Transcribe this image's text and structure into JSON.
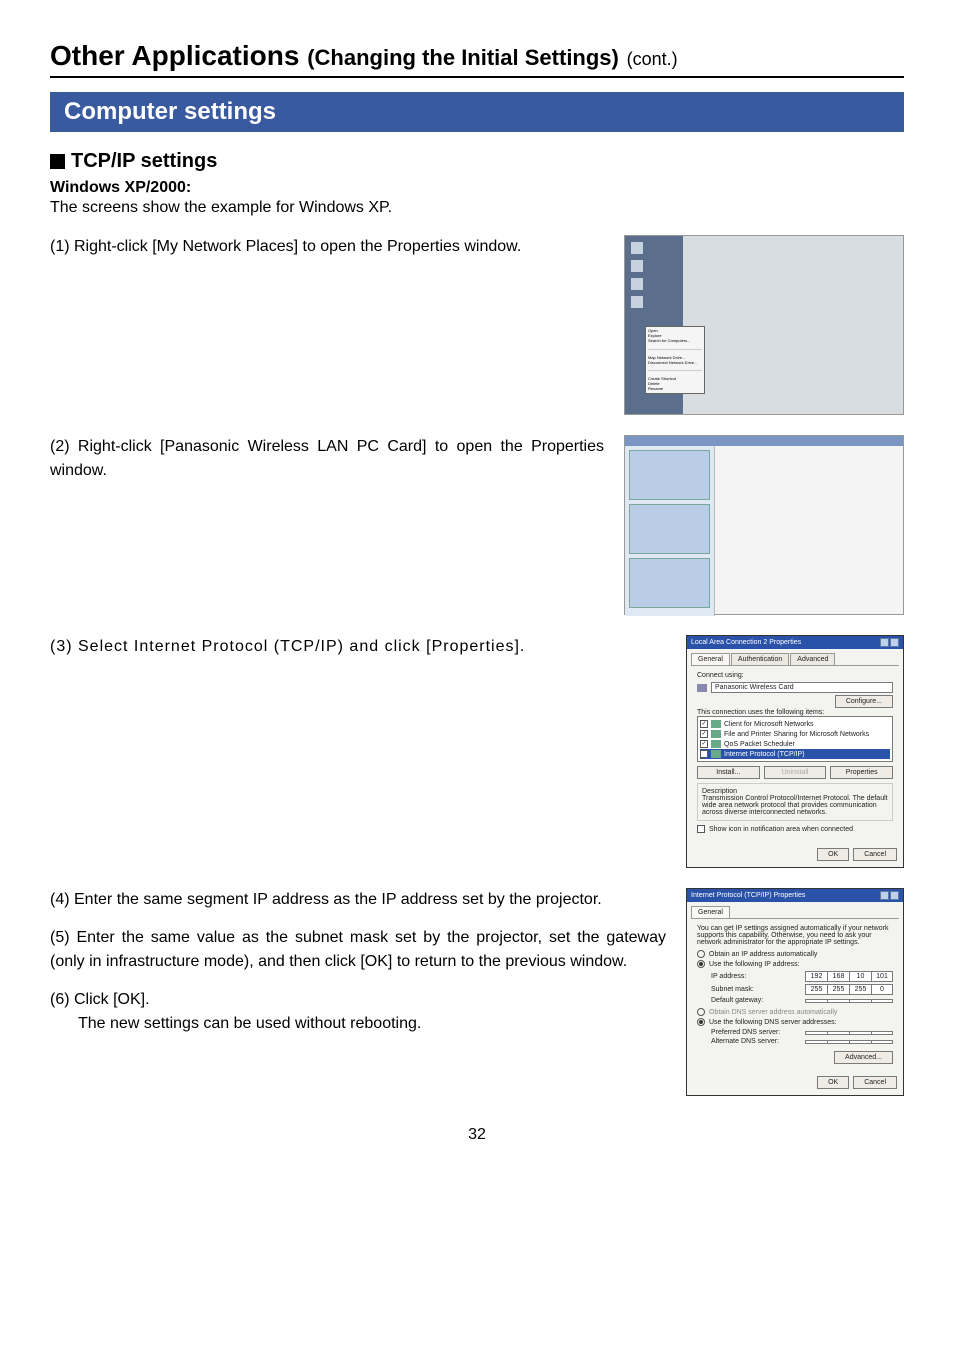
{
  "page": {
    "chapter_title_main": "Other Applications",
    "chapter_title_sub": "(Changing the Initial Settings)",
    "chapter_title_cont": "(cont.)",
    "section_title": "Computer settings",
    "subheading": "TCP/IP settings",
    "os_line": "Windows XP/2000:",
    "intro": "The screens show the example for Windows XP.",
    "step1": "(1) Right-click [My Network Places] to open the Properties window.",
    "step2": "(2) Right-click [Panasonic Wireless LAN PC Card] to open the Properties window.",
    "step3": "(3) Select Internet Protocol (TCP/IP) and click [Properties].",
    "step4": "(4) Enter the same segment IP address as the IP address set by the projector.",
    "step5": "(5) Enter the same value as the subnet mask set by the projector, set the gateway (only in infrastructure mode), and then click [OK] to return to the previous window.",
    "step6_a": "(6) Click [OK].",
    "step6_b": "The new settings can be used without rebooting.",
    "page_number": "32"
  },
  "ctx_menu": {
    "items": [
      "Open",
      "Explore",
      "Search for Computers...",
      "Map Network Drive...",
      "Disconnect Network Drive...",
      "Create Shortcut",
      "Delete",
      "Rename"
    ]
  },
  "shot3": {
    "title": "Local Area Connection 2 Properties",
    "tab_general": "General",
    "tab_auth": "Authentication",
    "tab_adv": "Advanced",
    "connect_using": "Connect using:",
    "adapter": "Panasonic Wireless Card",
    "configure": "Configure...",
    "uses_items": "This connection uses the following items:",
    "item_client": "Client for Microsoft Networks",
    "item_fp": "File and Printer Sharing for Microsoft Networks",
    "item_qos": "QoS Packet Scheduler",
    "item_tcpip": "Internet Protocol (TCP/IP)",
    "install": "Install...",
    "uninstall": "Uninstall",
    "properties": "Properties",
    "desc_head": "Description",
    "desc_body": "Transmission Control Protocol/Internet Protocol. The default wide area network protocol that provides communication across diverse interconnected networks.",
    "show_icon": "Show icon in notification area when connected",
    "ok": "OK",
    "cancel": "Cancel"
  },
  "shot4": {
    "title": "Internet Protocol (TCP/IP) Properties",
    "tab_general": "General",
    "blurb": "You can get IP settings assigned automatically if your network supports this capability. Otherwise, you need to ask your network administrator for the appropriate IP settings.",
    "r_auto_ip": "Obtain an IP address automatically",
    "r_use_ip": "Use the following IP address:",
    "ip_label": "IP address:",
    "ip": [
      "192",
      "168",
      "10",
      "101"
    ],
    "mask_label": "Subnet mask:",
    "mask": [
      "255",
      "255",
      "255",
      "0"
    ],
    "gw_label": "Default gateway:",
    "gw": [
      ".",
      ".",
      ".",
      "."
    ],
    "r_auto_dns": "Obtain DNS server address automatically",
    "r_use_dns": "Use the following DNS server addresses:",
    "pref_dns": "Preferred DNS server:",
    "alt_dns": "Alternate DNS server:",
    "advanced": "Advanced...",
    "ok": "OK",
    "cancel": "Cancel"
  }
}
